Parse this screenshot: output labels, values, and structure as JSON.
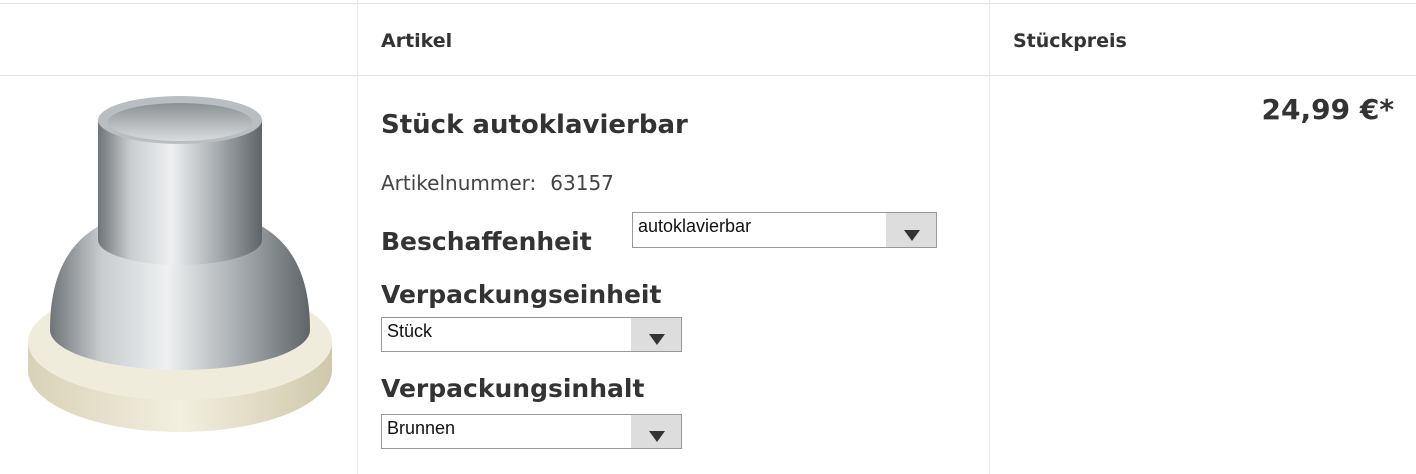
{
  "table": {
    "headers": {
      "article": "Artikel",
      "price": "Stückpreis"
    }
  },
  "product": {
    "image_icon": "aluminum-cup-icon",
    "title": "Stück autoklavierbar",
    "article_number_label": "Artikelnummer:",
    "article_number": "63157",
    "price": "24,99 €*"
  },
  "options": {
    "beschaffenheit": {
      "label": "Beschaffenheit",
      "value": "autoklavierbar"
    },
    "verpackungseinheit": {
      "label": "Verpackungseinheit",
      "value": "Stück"
    },
    "verpackungsinhalt": {
      "label": "Verpackungsinhalt",
      "value": "Brunnen"
    }
  },
  "colors": {
    "border": "#e6e6e6",
    "text": "#333333",
    "select_arrow_bg": "#dddddd"
  }
}
